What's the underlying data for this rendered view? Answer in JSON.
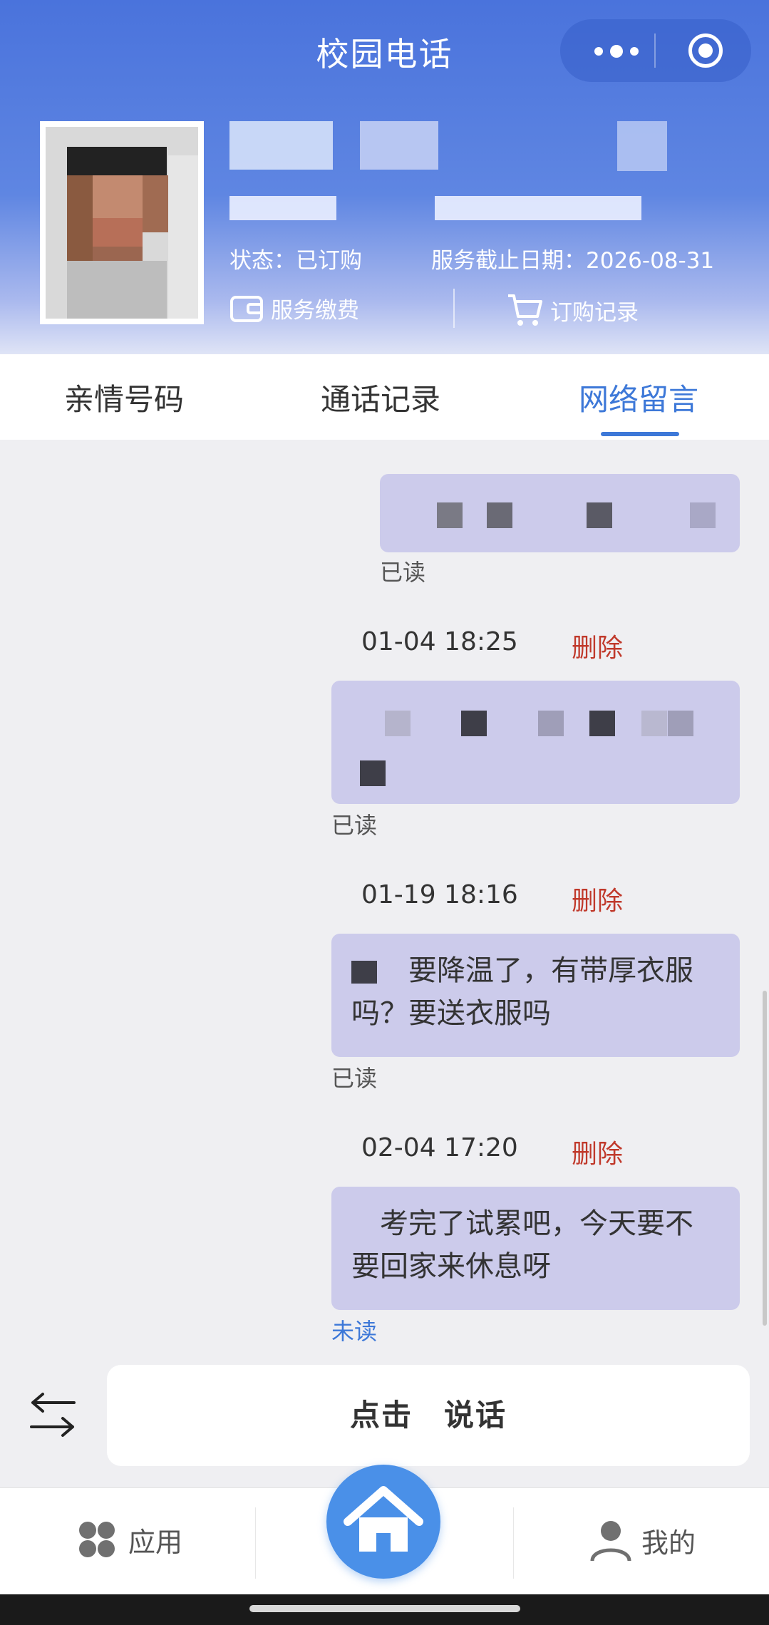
{
  "header": {
    "title": "校园电话",
    "status_text": "状态：已订购",
    "deadline_text": "服务截止日期：2026-08-31",
    "pay_label": "服务缴费",
    "orders_label": "订购记录"
  },
  "tabs": [
    {
      "label": "亲情号码",
      "active": false
    },
    {
      "label": "通话记录",
      "active": false
    },
    {
      "label": "网络留言",
      "active": true
    }
  ],
  "messages": [
    {
      "time": "",
      "delete_label": "",
      "text": "",
      "status": "已读"
    },
    {
      "time": "01-04 18:25",
      "delete_label": "删除",
      "text": "",
      "status": "已读"
    },
    {
      "time": "01-19 18:16",
      "delete_label": "删除",
      "text": "要降温了，有带厚衣服吗？要送衣服吗",
      "status": "已读"
    },
    {
      "time": "02-04 17:20",
      "delete_label": "删除",
      "text": "考完了试累吧，今天要不要回家来休息呀",
      "status": "未读"
    }
  ],
  "input": {
    "speak_label": "点击　说话"
  },
  "nav": {
    "apps_label": "应用",
    "mine_label": "我的"
  },
  "colors": {
    "header_blue": "#4a73dc",
    "active_tab": "#3d78d8",
    "bubble": "#cccbeb",
    "delete_red": "#c0392b",
    "unread_blue": "#3d78d8"
  },
  "icons": [
    "more-dots-icon",
    "target-close-icon",
    "wallet-icon",
    "cart-icon",
    "swap-arrows-icon",
    "apps-icon",
    "home-icon",
    "user-icon"
  ]
}
